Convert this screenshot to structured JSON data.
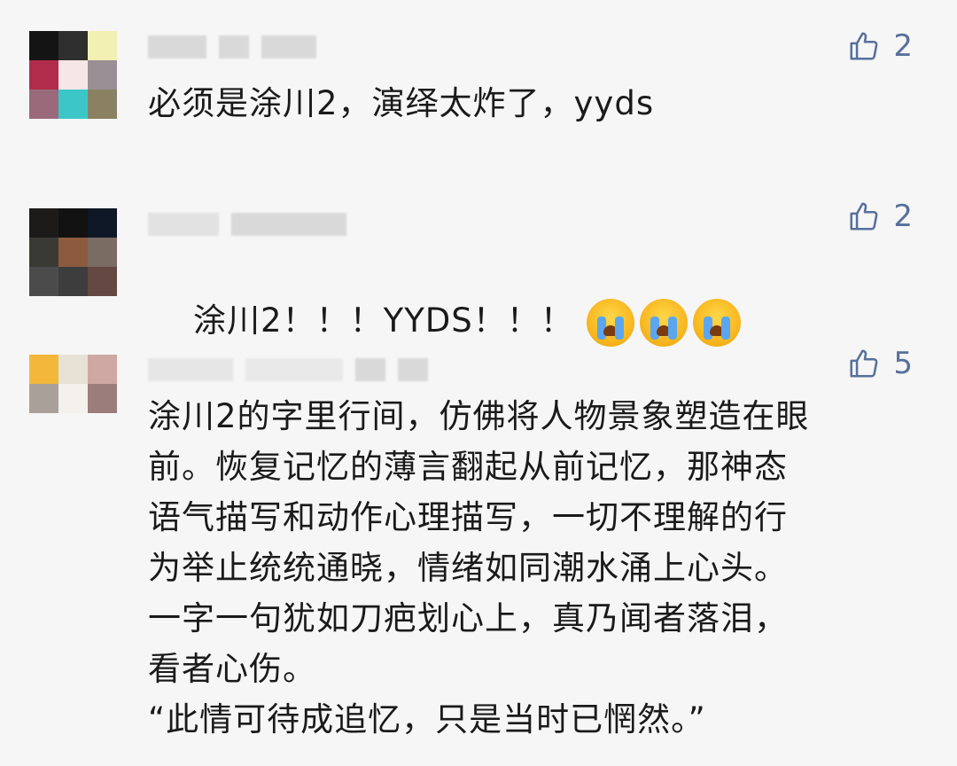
{
  "comments": [
    {
      "likes": "2",
      "text": "必须是涂川2，演绎太炸了，yyds",
      "avatar_colors": [
        "#141414",
        "#2f2f2f",
        "#f3f0b4",
        "#b02c4a",
        "#f7e6e6",
        "#9a8f95",
        "#9a6a7a",
        "#3cc6c8",
        "#8a8162"
      ]
    },
    {
      "likes": "2",
      "text": "涂川2！！！YYDS！！！",
      "emojis": [
        "crying-face",
        "crying-face",
        "crying-face"
      ],
      "avatar_colors": [
        "#1d1b1a",
        "#121212",
        "#0f1827",
        "#3a3a35",
        "#8c5b3e",
        "#7a6b63",
        "#4b4b4b",
        "#3d3d3d",
        "#654842"
      ]
    },
    {
      "likes": "5",
      "text": "涂川2的字里行间，仿佛将人物景象塑造在眼\n前。恢复记忆的薄言翻起从前记忆，那神态\n语气描写和动作心理描写，一切不理解的行\n为举止统统通晓，情绪如同潮水涌上心头。\n一字一句犹如刀疤划心上，真乃闻者落泪，\n看者心伤。\n“此情可待成追忆，只是当时已惘然。”",
      "avatar_colors": [
        "#f2b73b",
        "#e6e2d5",
        "#cfa8a3",
        "#a9a09a",
        "#f4f1ec",
        "#9b7d7b",
        "#f6f6f6",
        "#f6f6f6",
        "#f6f6f6"
      ]
    }
  ],
  "icons": {
    "like": "thumbs-up-icon"
  },
  "colors": {
    "like": "#57709c",
    "background": "#f6f6f6",
    "text": "#1a1a1a"
  }
}
